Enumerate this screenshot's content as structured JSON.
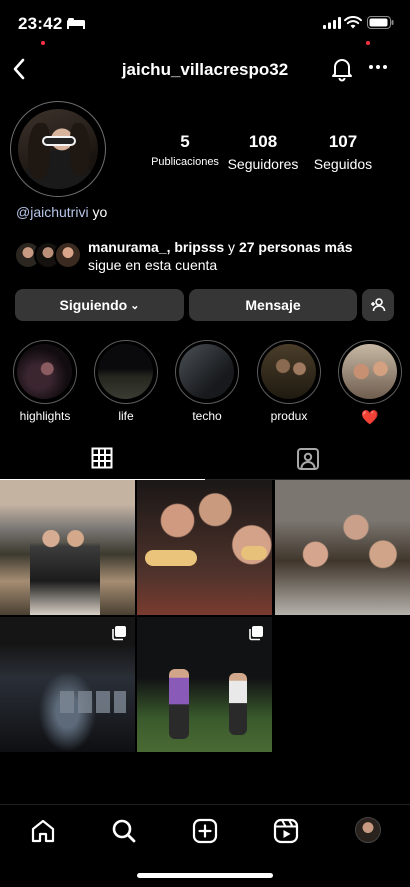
{
  "status_bar": {
    "time": "23:42"
  },
  "header": {
    "username": "jaichu_villacrespo32"
  },
  "profile": {
    "stats": [
      {
        "value": "5",
        "label": "Publicaciones"
      },
      {
        "value": "108",
        "label": "Seguidores"
      },
      {
        "value": "107",
        "label": "Seguidos"
      }
    ],
    "bio_handle": "@jaichutrivi",
    "bio_text": " yo",
    "followed_by_names": "manurama_, bripsss",
    "followed_by_connector": " y ",
    "followed_by_count": "27 personas más",
    "followed_by_line2": "sigue en esta cuenta"
  },
  "actions": {
    "following_label": "Siguiendo",
    "message_label": "Mensaje"
  },
  "highlights": [
    {
      "label": "highlights"
    },
    {
      "label": "life"
    },
    {
      "label": "techo"
    },
    {
      "label": "produx"
    },
    {
      "label": "❤️"
    }
  ],
  "tabs": {
    "active": "posts-grid"
  },
  "posts": [
    {
      "type": "photo"
    },
    {
      "type": "photo"
    },
    {
      "type": "photo"
    },
    {
      "type": "carousel"
    },
    {
      "type": "carousel"
    }
  ],
  "icons": {
    "back": "back-arrow-icon",
    "bell": "bell-icon",
    "more": "more-icon",
    "grid": "grid-icon",
    "tagged": "tagged-icon",
    "home": "home-icon",
    "search": "search-icon",
    "create": "create-icon",
    "reels": "reels-icon"
  },
  "colors": {
    "background": "#000000",
    "button_bg": "#363636",
    "notification_dot": "#ff3040"
  }
}
